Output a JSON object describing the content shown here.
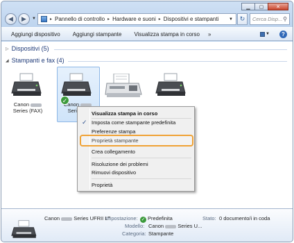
{
  "window": {
    "caption_buttons": {
      "minimize": "▁",
      "maximize": "▢",
      "close": "✕"
    }
  },
  "address_bar": {
    "back_glyph": "◀",
    "forward_glyph": "▶",
    "breadcrumbs": [
      "Pannello di controllo",
      "Hardware e suoni",
      "Dispositivi e stampanti"
    ],
    "separator": "▸",
    "refresh_glyph": "↻",
    "search_placeholder": "Cerca Disp...",
    "search_icon": "search-icon"
  },
  "toolbar": {
    "items": [
      "Aggiungi dispositivo",
      "Aggiungi stampante",
      "Visualizza stampa in corso"
    ],
    "more": "»",
    "help": "?"
  },
  "groups": {
    "devices": {
      "label": "Dispositivi (5)",
      "collapsed": true
    },
    "printers": {
      "label": "Stampanti e fax (4)",
      "collapsed": false
    }
  },
  "printers": [
    {
      "name_line1_prefix": "Canon",
      "name_line2": "Series (FAX)",
      "default": false
    },
    {
      "name_line1_prefix": "Canon",
      "name_line2": "Series U",
      "default": true
    },
    {
      "name_line1_prefix": "",
      "name_line2": "",
      "default": false
    },
    {
      "name_line1_prefix": "",
      "name_line2": "",
      "default": false
    }
  ],
  "context_menu": {
    "items": [
      {
        "label": "Visualizza stampa in corso",
        "bold": true,
        "checked": false
      },
      {
        "label": "Imposta come stampante predefinita",
        "bold": false,
        "checked": true
      },
      {
        "label": "Preferenze stampa",
        "bold": false,
        "checked": false
      },
      {
        "label": "Proprietà stampante",
        "bold": false,
        "checked": false,
        "highlighted": true
      },
      {
        "label": "Crea collegamento",
        "bold": false,
        "checked": false
      },
      {
        "label": "Risoluzione dei problemi",
        "bold": false,
        "checked": false
      },
      {
        "label": "Rimuovi dispositivo",
        "bold": false,
        "checked": false
      },
      {
        "label": "Proprietà",
        "bold": false,
        "checked": false
      }
    ],
    "check_glyph": "✓"
  },
  "details": {
    "name_prefix": "Canon",
    "name_suffix": "Series UFRII LT",
    "impostazione_label": "Impostazione:",
    "impostazione_value": "Predefinita",
    "stato_label": "Stato:",
    "stato_value": "0 documento/i in coda",
    "modello_label": "Modello:",
    "modello_prefix": "Canon",
    "modello_suffix": "Series U...",
    "categoria_label": "Categoria:",
    "categoria_value": "Stampante"
  },
  "colors": {
    "highlight_border": "#f0a235",
    "group_header_text": "#1e3a78",
    "default_check": "#3c9a3c"
  }
}
